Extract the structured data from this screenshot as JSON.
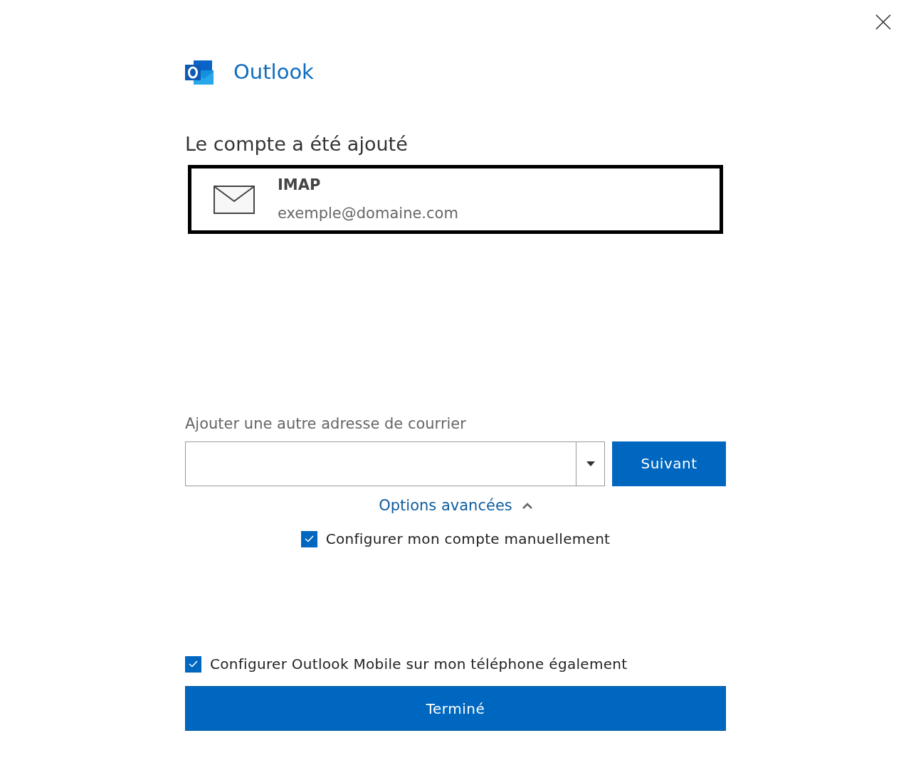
{
  "app": {
    "name": "Outlook"
  },
  "heading": "Le compte a été ajouté",
  "account": {
    "type": "IMAP",
    "email": "exemple@domaine.com",
    "selected": true
  },
  "add_address": {
    "label": "Ajouter une autre adresse de courrier",
    "next_button": "Suivant"
  },
  "advanced_options": {
    "label": "Options avancées",
    "expanded": true,
    "options": [
      {
        "label": "Configurer mon compte manuellement",
        "checked": true
      }
    ]
  },
  "mobile_option": {
    "label": "Configurer Outlook Mobile sur mon téléphone également",
    "checked": true
  },
  "done_button": "Terminé"
}
